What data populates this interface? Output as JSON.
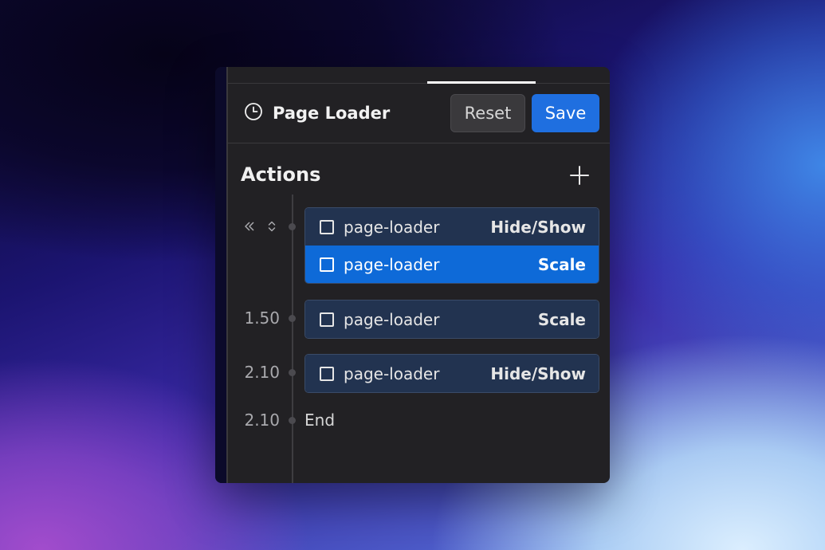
{
  "panel": {
    "title": "Page Loader",
    "title_icon": "clock-icon",
    "reset_label": "Reset",
    "save_label": "Save"
  },
  "actions": {
    "heading": "Actions",
    "add_icon": "plus-icon",
    "groups": [
      {
        "time": "",
        "controls": [
          "rewind-icon",
          "expand-collapse-icon"
        ],
        "rows": [
          {
            "element": "page-loader",
            "action": "Hide/Show",
            "selected": false
          },
          {
            "element": "page-loader",
            "action": "Scale",
            "selected": true
          }
        ]
      },
      {
        "time": "1.50",
        "rows": [
          {
            "element": "page-loader",
            "action": "Scale",
            "selected": false
          }
        ]
      },
      {
        "time": "2.10",
        "rows": [
          {
            "element": "page-loader",
            "action": "Hide/Show",
            "selected": false
          }
        ]
      }
    ],
    "end": {
      "time": "2.10",
      "label": "End"
    }
  },
  "colors": {
    "panel_bg": "#222124",
    "accent": "#1f6fe0",
    "selected_row": "#0e6ad8",
    "row_bg": "#223350"
  }
}
